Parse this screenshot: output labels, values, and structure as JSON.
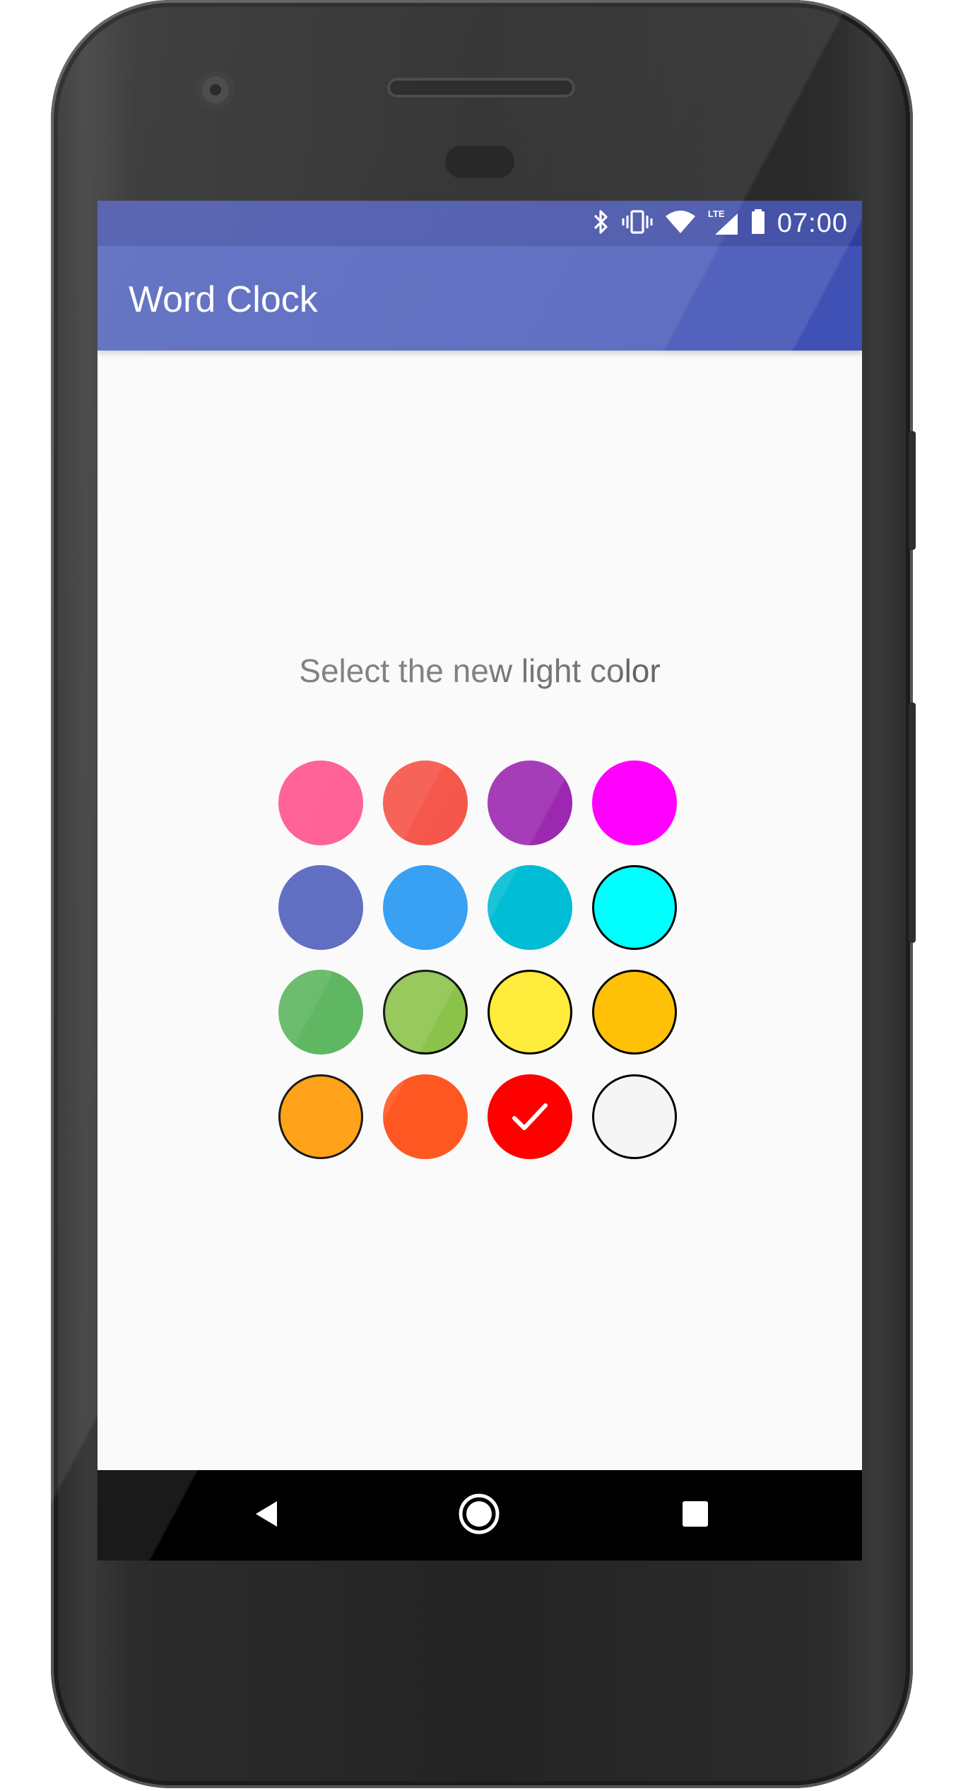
{
  "status_bar": {
    "time": "07:00",
    "network_label": "LTE",
    "icons": [
      "bluetooth-icon",
      "vibrate-icon",
      "wifi-icon",
      "lte-signal-icon",
      "battery-icon"
    ]
  },
  "app_bar": {
    "title": "Word Clock"
  },
  "main": {
    "prompt": "Select the new light color",
    "selected_index": 14,
    "swatches": [
      {
        "color": "#ff4081",
        "bordered": false
      },
      {
        "color": "#f44336",
        "bordered": false
      },
      {
        "color": "#9c27b0",
        "bordered": false
      },
      {
        "color": "#ff00ff",
        "bordered": false
      },
      {
        "color": "#3f51b5",
        "bordered": false
      },
      {
        "color": "#2196f3",
        "bordered": false
      },
      {
        "color": "#00bcd4",
        "bordered": false
      },
      {
        "color": "#00ffff",
        "bordered": true
      },
      {
        "color": "#4caf50",
        "bordered": false
      },
      {
        "color": "#8bc34a",
        "bordered": true
      },
      {
        "color": "#ffeb3b",
        "bordered": true
      },
      {
        "color": "#ffc107",
        "bordered": true
      },
      {
        "color": "#ff9800",
        "bordered": true
      },
      {
        "color": "#ff5722",
        "bordered": false
      },
      {
        "color": "#ff0000",
        "bordered": false
      },
      {
        "color": "#f5f5f5",
        "bordered": true
      }
    ]
  },
  "nav_bar": {
    "icons": [
      "back-icon",
      "home-icon",
      "recents-icon"
    ]
  },
  "colors": {
    "status_bar": "#303f9f",
    "app_bar": "#3f51b5",
    "background": "#fafafa",
    "prompt_text": "#666666"
  }
}
